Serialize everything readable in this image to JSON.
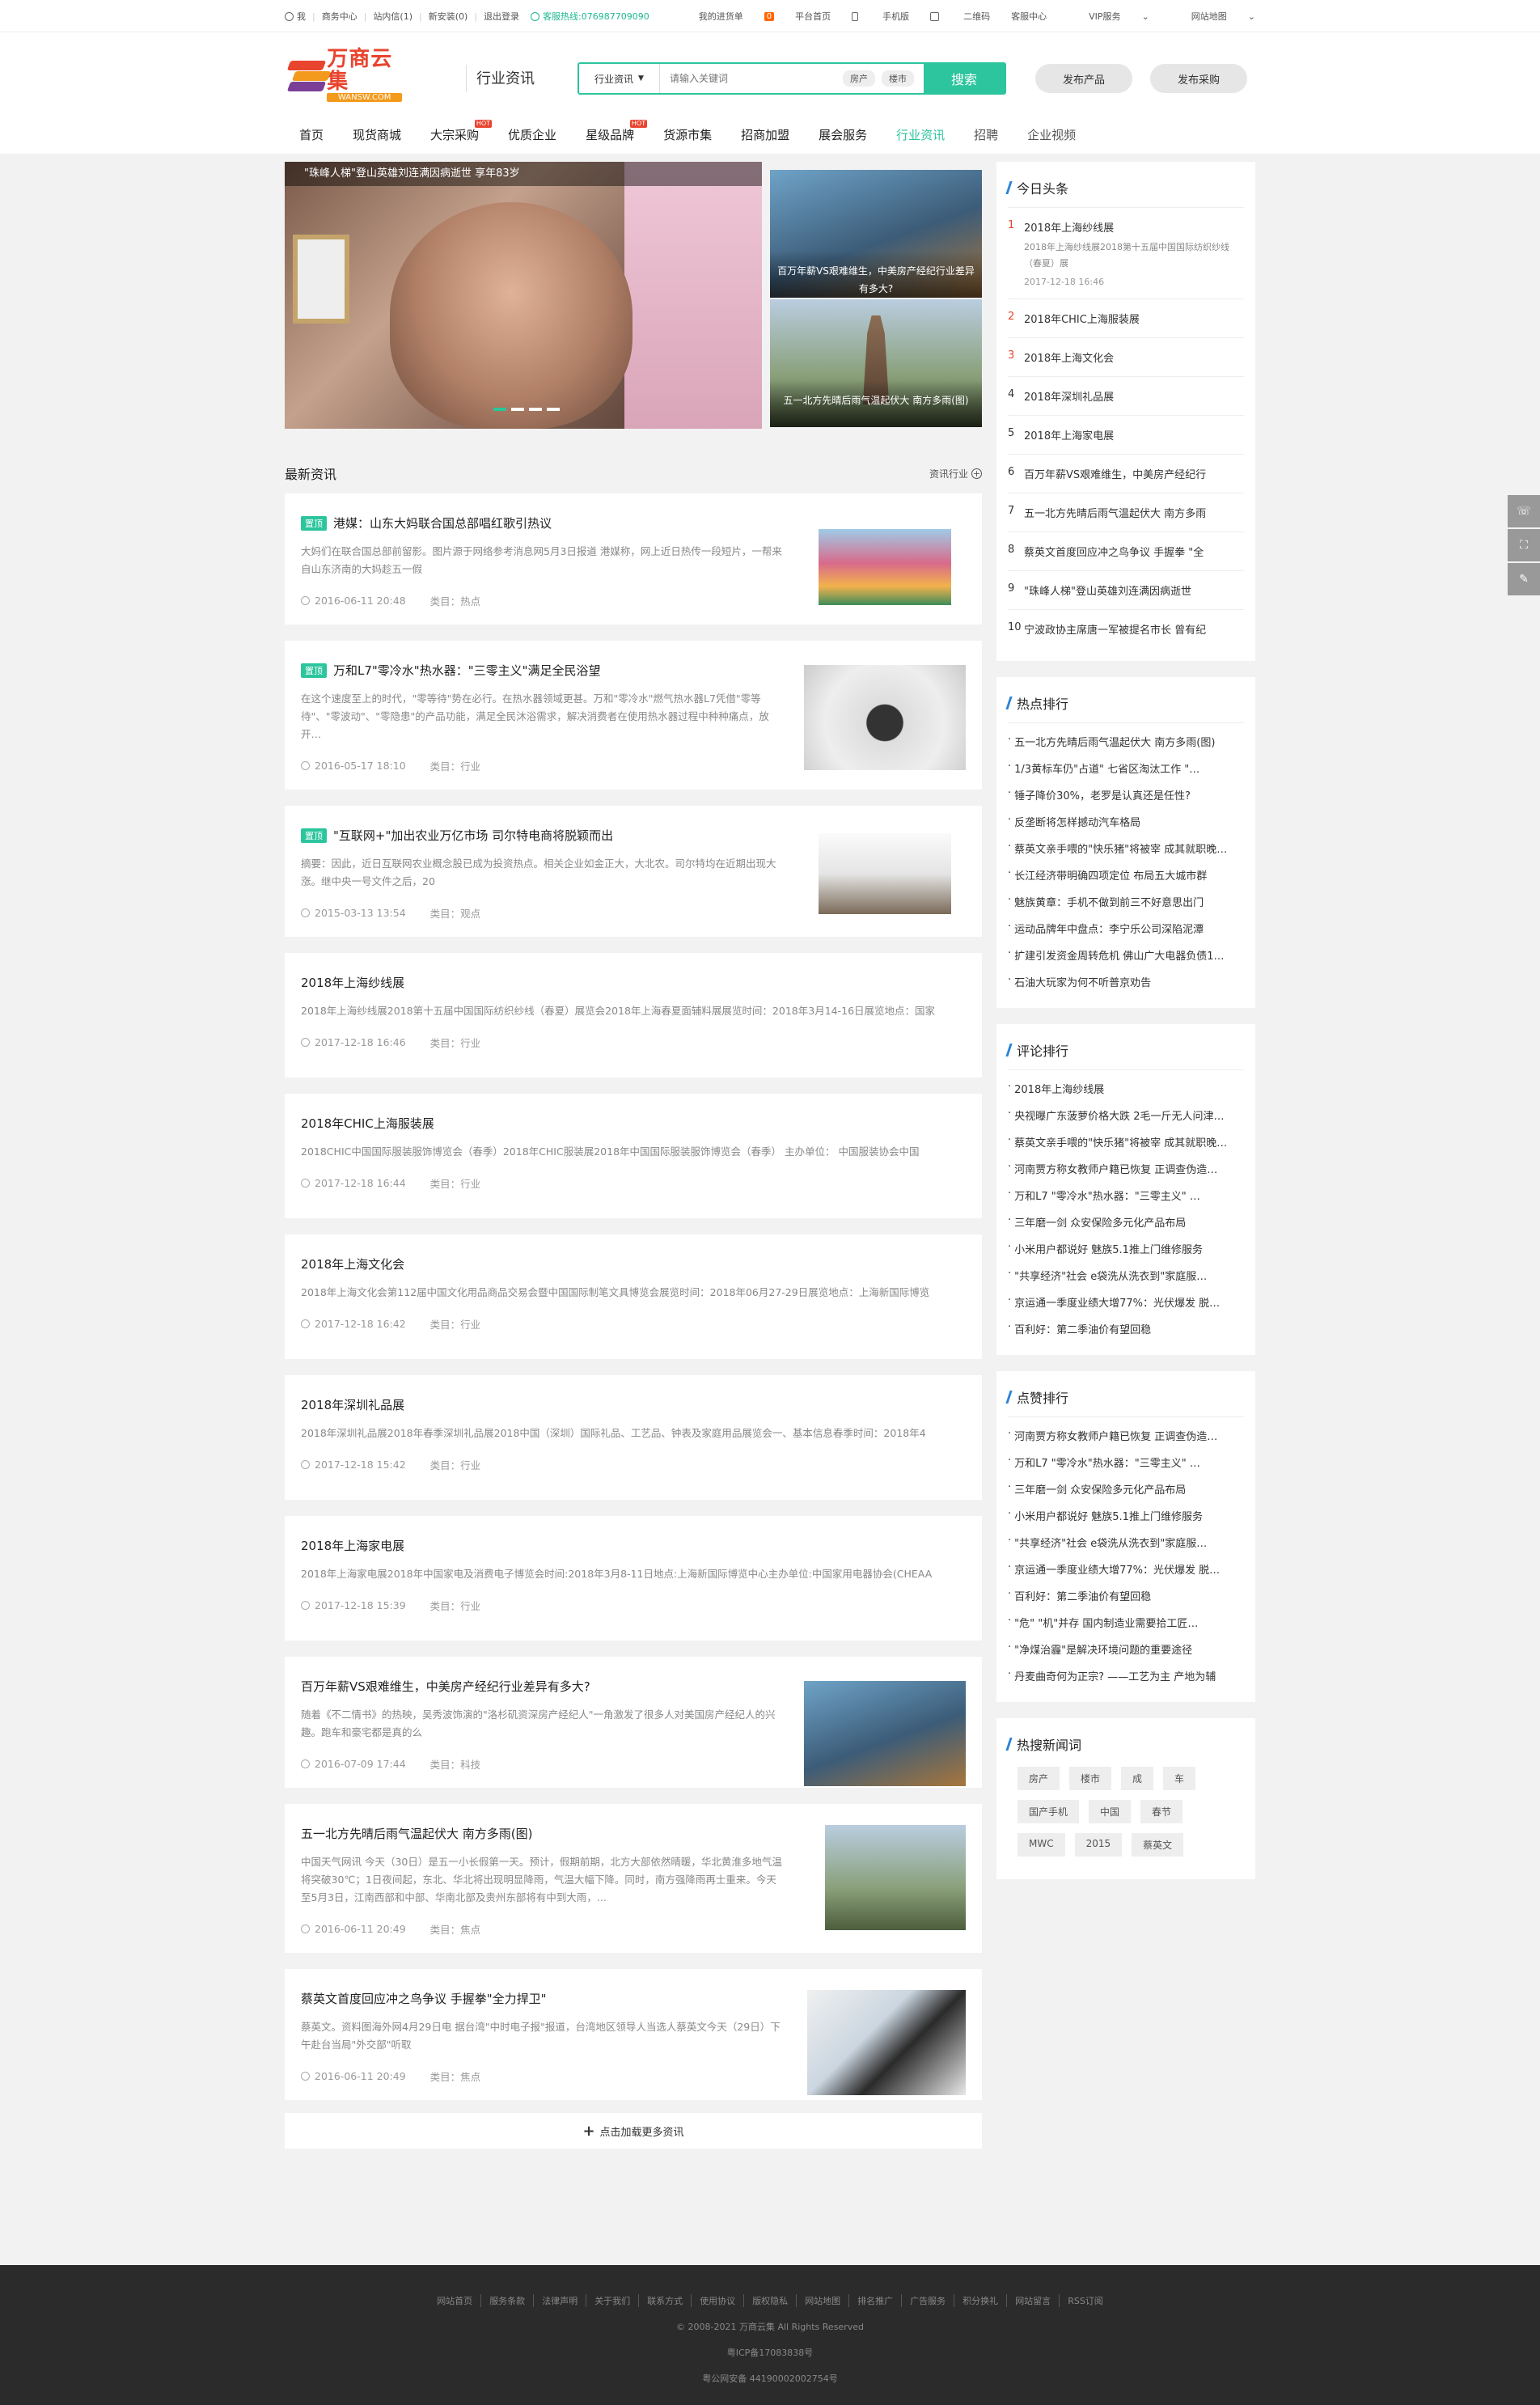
{
  "topbar": {
    "left": [
      "我",
      "商务中心",
      "站内信(1)",
      "新安装(0)",
      "退出登录"
    ],
    "hotline_label": "客服热线:",
    "hotline": "076987709090",
    "right": [
      "我的进货单",
      "平台首页",
      "手机版",
      "二维码",
      "客服中心",
      "VIP服务",
      "网站地图"
    ],
    "cart_count": "0"
  },
  "header": {
    "logo_cn": "万商云集",
    "logo_en": "WANSW.COM",
    "channel": "行业资讯",
    "search_select": "行业资讯",
    "search_placeholder": "请输入关键词",
    "search_tags": [
      "房产",
      "楼市"
    ],
    "search_button": "搜索",
    "publish_product": "发布产品",
    "publish_purchase": "发布采购"
  },
  "nav": [
    {
      "label": "首页",
      "hot": ""
    },
    {
      "label": "现货商城",
      "hot": ""
    },
    {
      "label": "大宗采购",
      "hot": "HOT"
    },
    {
      "label": "优质企业",
      "hot": ""
    },
    {
      "label": "星级品牌",
      "hot": "HOT"
    },
    {
      "label": "货源市集",
      "hot": ""
    },
    {
      "label": "招商加盟",
      "hot": ""
    },
    {
      "label": "展会服务",
      "hot": ""
    },
    {
      "label": "行业资讯",
      "hot": ""
    },
    {
      "label": "招聘",
      "hot": ""
    },
    {
      "label": "企业视频",
      "hot": ""
    }
  ],
  "slider": {
    "big_caption": "\"珠峰人梯\"登山英雄刘连满因病逝世 享年83岁",
    "small": [
      "百万年薪VS艰难维生，中美房产经纪行业差异有多大?",
      "五一北方先晴后雨气温起伏大 南方多雨(图)"
    ]
  },
  "latest": {
    "title": "最新资讯",
    "more": "资讯行业",
    "cat_label": "类目：",
    "items": [
      {
        "top": "置顶",
        "title": "港媒：山东大妈联合国总部唱红歌引热议",
        "desc": "大妈们在联合国总部前留影。图片源于网络参考消息网5月3日报道 港媒称，网上近日热传一段短片，一帮来自山东济南的大妈趁五一假",
        "date": "2016-06-11 20:48",
        "cat": "热点"
      },
      {
        "top": "置顶",
        "title": "万和L7\"零冷水\"热水器：\"三零主义\"满足全民浴望",
        "desc": "在这个速度至上的时代，\"零等待\"势在必行。在热水器领域更甚。万和\"零冷水\"燃气热水器L7凭借\"零等待\"、\"零波动\"、\"零隐患\"的产品功能，满足全民沐浴需求，解决消费者在使用热水器过程中种种痛点，放开…",
        "date": "2016-05-17 18:10",
        "cat": "行业"
      },
      {
        "top": "置顶",
        "title": "\"互联网+\"加出农业万亿市场 司尔特电商将脱颖而出",
        "desc": "摘要：因此，近日互联网农业概念股已成为投资热点。相关企业如金正大，大北农。司尔特均在近期出现大涨。继中央一号文件之后，20",
        "date": "2015-03-13 13:54",
        "cat": "观点"
      },
      {
        "top": "",
        "title": "2018年上海纱线展",
        "desc": "2018年上海纱线展2018第十五届中国国际纺织纱线（春夏）展览会2018年上海春夏面辅料展展览时间：2018年3月14-16日展览地点：国家",
        "date": "2017-12-18 16:46",
        "cat": "行业"
      },
      {
        "top": "",
        "title": "2018年CHIC上海服装展",
        "desc": "2018CHIC中国国际服装服饰博览会（春季）2018年CHIC服装展2018年中国国际服装服饰博览会（春季） 主办单位： 中国服装协会中国",
        "date": "2017-12-18 16:44",
        "cat": "行业"
      },
      {
        "top": "",
        "title": "2018年上海文化会",
        "desc": "2018年上海文化会第112届中国文化用品商品交易会暨中国国际制笔文具博览会展览时间：2018年06月27-29日展览地点：上海新国际博览",
        "date": "2017-12-18 16:42",
        "cat": "行业"
      },
      {
        "top": "",
        "title": "2018年深圳礼品展",
        "desc": "2018年深圳礼品展2018年春季深圳礼品展2018中国（深圳）国际礼品、工艺品、钟表及家庭用品展览会一、基本信息春季时间：2018年4",
        "date": "2017-12-18 15:42",
        "cat": "行业"
      },
      {
        "top": "",
        "title": "2018年上海家电展",
        "desc": "2018年上海家电展2018年中国家电及消费电子博览会时间:2018年3月8-11日地点:上海新国际博览中心主办单位:中国家用电器协会(CHEAA",
        "date": "2017-12-18 15:39",
        "cat": "行业"
      },
      {
        "top": "",
        "title": "百万年薪VS艰难维生，中美房产经纪行业差异有多大?",
        "desc": "随着《不二情书》的热映，吴秀波饰演的\"洛杉矶资深房产经纪人\"一角激发了很多人对美国房产经纪人的兴趣。跑车和豪宅都是真的么",
        "date": "2016-07-09 17:44",
        "cat": "科技"
      },
      {
        "top": "",
        "title": "五一北方先晴后雨气温起伏大 南方多雨(图)",
        "desc": "中国天气网讯 今天（30日）是五一小长假第一天。预计，假期前期，北方大部依然晴暖，华北黄淮多地气温将突破30℃；1日夜间起，东北、华北将出现明显降雨，气温大幅下降。同时，南方强降雨再士重来。今天至5月3日，江南西部和中部、华南北部及贵州东部将有中到大雨，...",
        "date": "2016-06-11 20:49",
        "cat": "焦点"
      },
      {
        "top": "",
        "title": "蔡英文首度回应冲之鸟争议 手握拳\"全力捍卫\"",
        "desc": "蔡英文。资料图海外网4月29日电 据台湾\"中时电子报\"报道，台湾地区领导人当选人蔡英文今天（29日）下午赴台当局\"外交部\"听取",
        "date": "2016-06-11 20:49",
        "cat": "焦点"
      }
    ],
    "load_more": "点击加载更多资讯"
  },
  "headline": {
    "title": "今日头条",
    "first": {
      "title": "2018年上海纱线展",
      "sub": "2018年上海纱线展2018第十五届中国国际纺织纱线（春夏）展",
      "date": "2017-12-18 16:46"
    },
    "items": [
      "2018年CHIC上海服装展",
      "2018年上海文化会",
      "2018年深圳礼品展",
      "2018年上海家电展",
      "百万年薪VS艰难维生，中美房产经纪行",
      "五一北方先晴后雨气温起伏大 南方多雨",
      "蔡英文首度回应冲之鸟争议 手握拳 \"全",
      "\"珠峰人梯\"登山英雄刘连满因病逝世",
      "宁波政协主席唐一军被提名市长 曾有纪"
    ]
  },
  "hot_rank": {
    "title": "热点排行",
    "items": [
      "五一北方先晴后雨气温起伏大 南方多雨(图)",
      "1/3黄标车仍\"占道\" 七省区淘汰工作 \"…",
      "锤子降价30%，老罗是认真还是任性?",
      "反垄断将怎样撼动汽车格局",
      "蔡英文亲手喂的\"快乐猪\"将被宰 成其就职晚…",
      "长江经济带明确四项定位 布局五大城市群",
      "魅族黄章：手机不做到前三不好意思出门",
      "运动品牌年中盘点：李宁乐公司深陷泥潭",
      "扩建引发资金周转危机 佛山广大电器负债1…",
      "石油大玩家为何不听普京劝告"
    ]
  },
  "comment_rank": {
    "title": "评论排行",
    "items": [
      "2018年上海纱线展",
      "央视曝广东菠萝价格大跌 2毛一斤无人问津…",
      "蔡英文亲手喂的\"快乐猪\"将被宰 成其就职晚…",
      "河南贾方称女教师户籍已恢复 正调查伪造…",
      "万和L7 \"零冷水\"热水器：\"三零主义\" …",
      "三年磨一剑 众安保险多元化产品布局",
      "小米用户都说好 魅族5.1推上门维修服务",
      "\"共享经济\"社会 e袋洗从洗衣到\"家庭服…",
      "京运通一季度业绩大增77%：光伏爆发 脱…",
      "百利好：第二季油价有望回稳"
    ]
  },
  "like_rank": {
    "title": "点赞排行",
    "items": [
      "河南贾方称女教师户籍已恢复 正调查伪造…",
      "万和L7 \"零冷水\"热水器：\"三零主义\" …",
      "三年磨一剑 众安保险多元化产品布局",
      "小米用户都说好 魅族5.1推上门维修服务",
      "\"共享经济\"社会 e袋洗从洗衣到\"家庭服…",
      "京运通一季度业绩大增77%：光伏爆发 脱…",
      "百利好：第二季油价有望回稳",
      "\"危\" \"机\"并存 国内制造业需要拾工匠…",
      "\"净煤治霾\"是解决环境问题的重要途径",
      "丹麦曲奇何为正宗? ——工艺为主 产地为辅"
    ]
  },
  "hot_search": {
    "title": "热搜新闻词",
    "tags": [
      "房产",
      "楼市",
      "成",
      "车",
      "国产手机",
      "中国",
      "春节",
      "MWC",
      "2015",
      "蔡英文"
    ]
  },
  "footer": {
    "links": [
      "网站首页",
      "服务条款",
      "法律声明",
      "关于我们",
      "联系方式",
      "使用协议",
      "版权隐私",
      "网站地图",
      "排名推广",
      "广告服务",
      "积分换礼",
      "网站留言",
      "RSS订阅"
    ],
    "copyright": "© 2008-2021 万商云集 All Rights Reserved",
    "icp": "粤ICP备17083838号",
    "police": "粤公网安备 44190002002754号"
  }
}
